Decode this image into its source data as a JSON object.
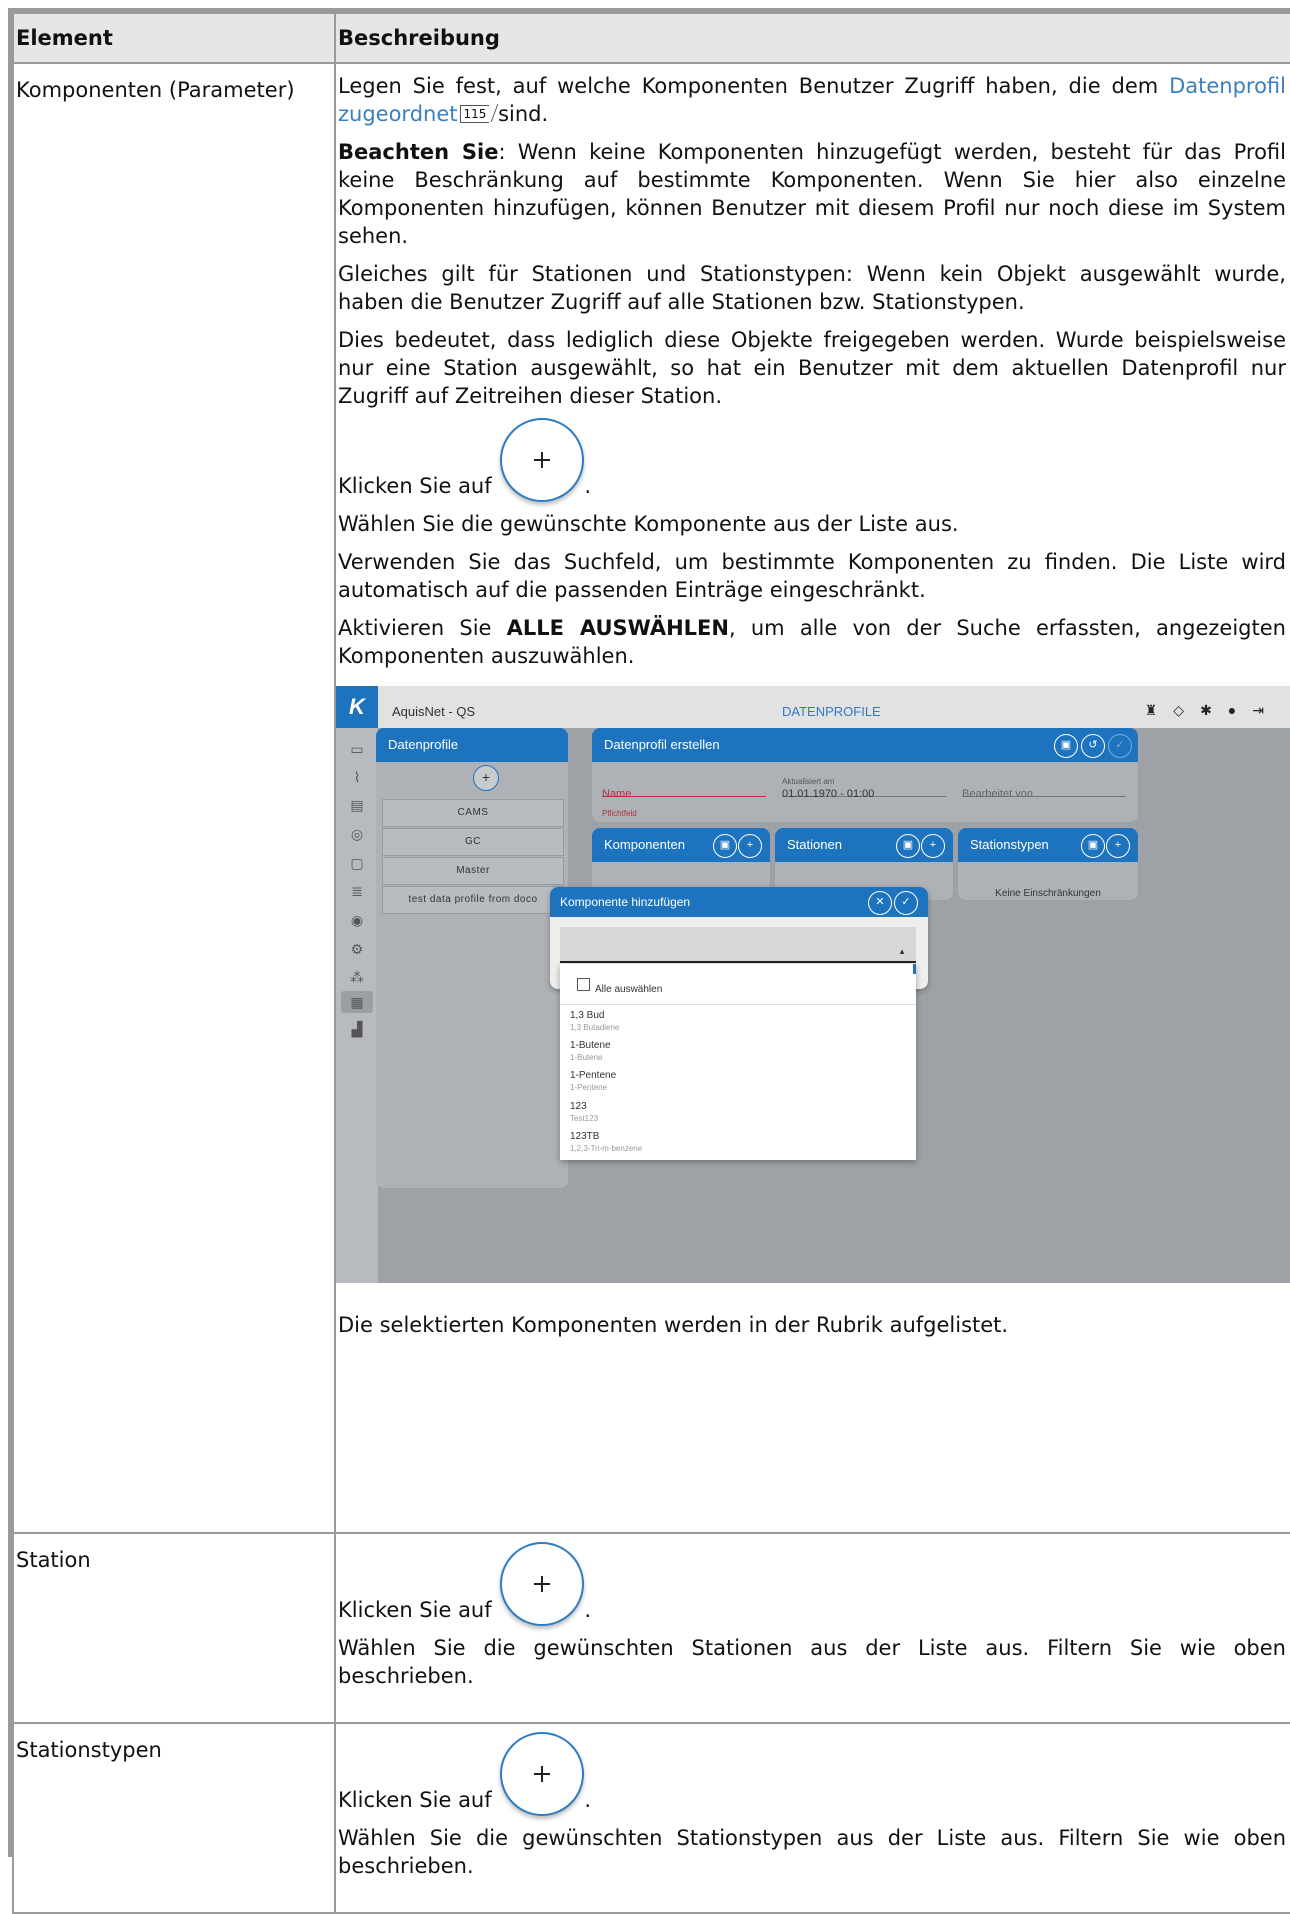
{
  "table": {
    "header_element": "Element",
    "header_description": "Beschreibung"
  },
  "row1": {
    "element": "Komponenten (Parameter)",
    "p1_text": "Legen Sie fest, auf welche Komponenten Benutzer Zugriff haben, die dem ",
    "p1_link": "Datenprofil zugeordnet",
    "p1_ref": "115",
    "p1_end": " sind.",
    "p2_bold": "Beachten Sie",
    "p2_text": ": Wenn keine Komponenten hinzugefügt werden, besteht für das Profil keine Beschränkung auf bestimmte Komponenten. Wenn Sie hier also einzelne Komponenten hinzufügen, können Benutzer mit diesem Profil nur noch diese im System sehen.",
    "p3": "Gleiches gilt für Stationen und Stationstypen: Wenn kein Objekt ausgewählt wurde, haben die Benutzer Zugriff auf alle Stationen bzw. Stationstypen.",
    "p4": "Dies bedeutet, dass lediglich diese Objekte freigegeben werden. Wurde beispielsweise nur eine Station ausgewählt, so hat ein Benutzer mit dem aktuellen Datenprofil nur Zugriff auf Zeitreihen dieser Station.",
    "click_text": "Klicken Sie auf ",
    "click_end": ".",
    "p6": "Wählen Sie die gewünschte Komponente aus der Liste aus.",
    "p7": "Verwenden Sie das Suchfeld, um bestimmte Komponenten zu finden. Die Liste wird automatisch auf die passenden Einträge eingeschränkt.",
    "p8_pre": "Aktivieren Sie ",
    "p8_bold": "ALLE AUSWÄHLEN",
    "p8_post": ", um alle von der Suche erfassten, angezeigten Komponenten auszuwählen.",
    "p9": "Die selektierten Komponenten werden in der Rubrik aufgelistet."
  },
  "screenshot": {
    "logo": "K",
    "app_name": "AquisNet - QS",
    "page_title": "DATENPROFILE",
    "left_panel_title": "Datenprofile",
    "profiles": [
      "CAMS",
      "GC",
      "Master",
      "test data profile from doco"
    ],
    "create_title": "Datenprofil erstellen",
    "name_label": "Name",
    "required": "Pflichtfeld",
    "updated_label": "Aktualisiert am",
    "updated_value": "01.01.1970 - 01:00",
    "edited_by": "Bearbeitet von",
    "sub_panels": [
      "Komponenten",
      "Stationen",
      "Stationstypen"
    ],
    "no_restrictions": "Keine Einschränkungen",
    "dialog_title": "Komponente hinzufügen",
    "select_all": "Alle auswählen",
    "options": [
      {
        "name": "1,3 Bud",
        "desc": "1,3 Butadiene"
      },
      {
        "name": "1-Butene",
        "desc": "1-Butene"
      },
      {
        "name": "1-Pentene",
        "desc": "1-Pentene"
      },
      {
        "name": "123",
        "desc": "Test123"
      },
      {
        "name": "123TB",
        "desc": "1,2,3-Tri-m-benzene"
      }
    ],
    "accent": "#1e73be"
  },
  "row2": {
    "element": "Station",
    "click_text": "Klicken Sie auf ",
    "click_end": ".",
    "p2": "Wählen Sie die gewünschten Stationen aus der Liste aus. Filtern Sie wie oben beschrieben."
  },
  "row3": {
    "element": "Stationstypen",
    "click_text": "Klicken Sie auf ",
    "click_end": ".",
    "p2": "Wählen Sie die gewünschten Stationstypen aus der Liste aus. Filtern Sie wie oben beschrieben."
  }
}
